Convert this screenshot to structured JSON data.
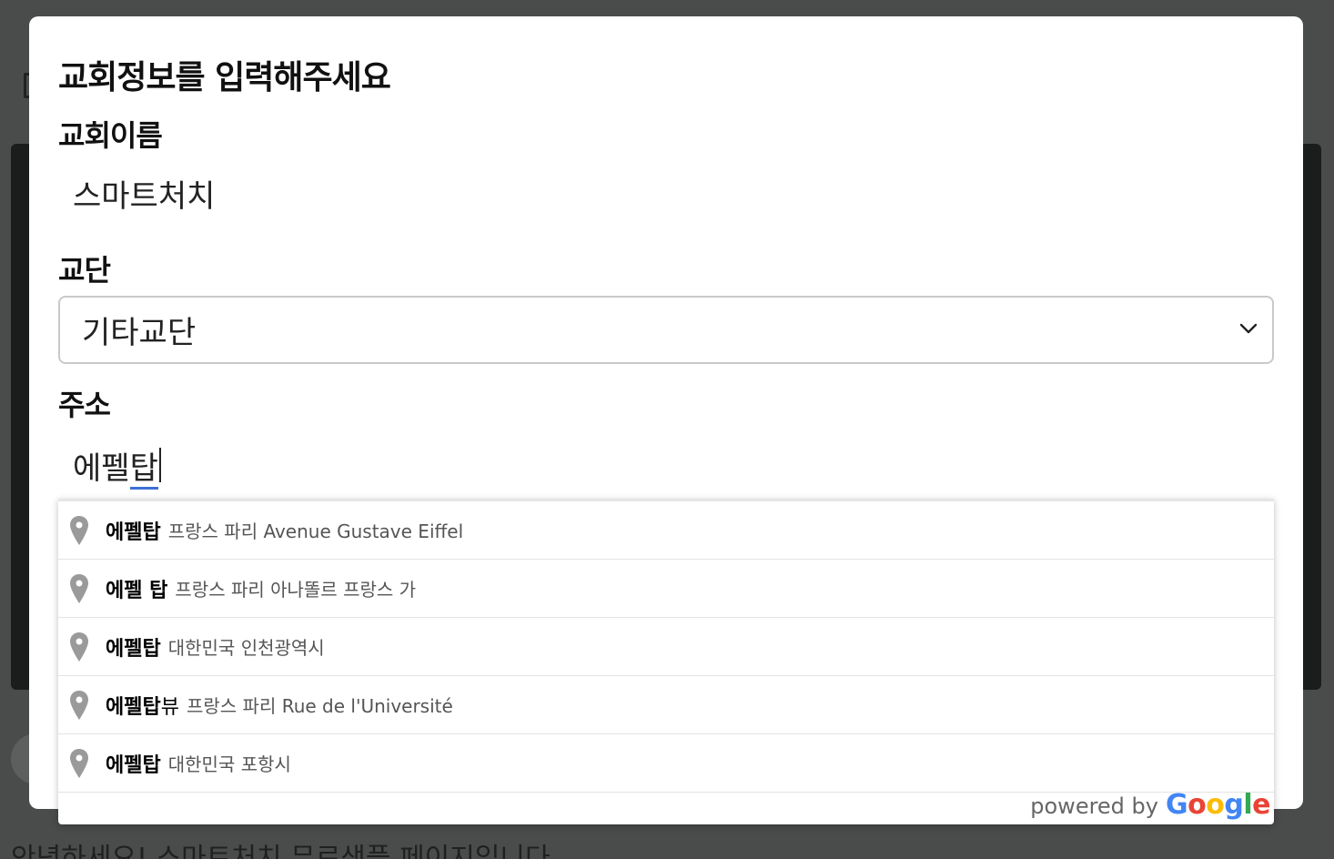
{
  "background": {
    "page_text": "안녕하세요! 스마트처치 무료샘플 페이지입니다"
  },
  "modal": {
    "title": "교회정보를 입력해주세요",
    "church_name": {
      "label": "교회이름",
      "value": "스마트처치"
    },
    "denomination": {
      "label": "교단",
      "selected": "기타교단"
    },
    "address": {
      "label": "주소",
      "value_committed": "에펠",
      "value_composing": "탑"
    }
  },
  "autocomplete": {
    "items": [
      {
        "main_bold": "에펠탑",
        "main_rest": "",
        "secondary": "프랑스 파리 Avenue Gustave Eiffel"
      },
      {
        "main_bold": "에펠 탑",
        "main_rest": "",
        "secondary": "프랑스 파리 아나똘르 프랑스 가"
      },
      {
        "main_bold": "에펠탑",
        "main_rest": "",
        "secondary": "대한민국 인천광역시"
      },
      {
        "main_bold": "에펠탑",
        "main_rest": "뷰",
        "secondary": "프랑스 파리 Rue de l'Université"
      },
      {
        "main_bold": "에펠탑",
        "main_rest": "",
        "secondary": "대한민국 포항시"
      }
    ],
    "powered_by": "powered by",
    "google": [
      "G",
      "o",
      "o",
      "g",
      "l",
      "e"
    ]
  },
  "icons": {
    "pin": "map-pin-icon",
    "chevron": "chevron-down-icon",
    "menu": "menu-icon"
  },
  "colors": {
    "overlay": "#4b4c4c",
    "modal_bg": "#ffffff",
    "composition_underline": "#3d6fd6",
    "google_blue": "#4285f4",
    "google_red": "#ea4335",
    "google_yellow": "#fbbc05",
    "google_green": "#34a853"
  }
}
